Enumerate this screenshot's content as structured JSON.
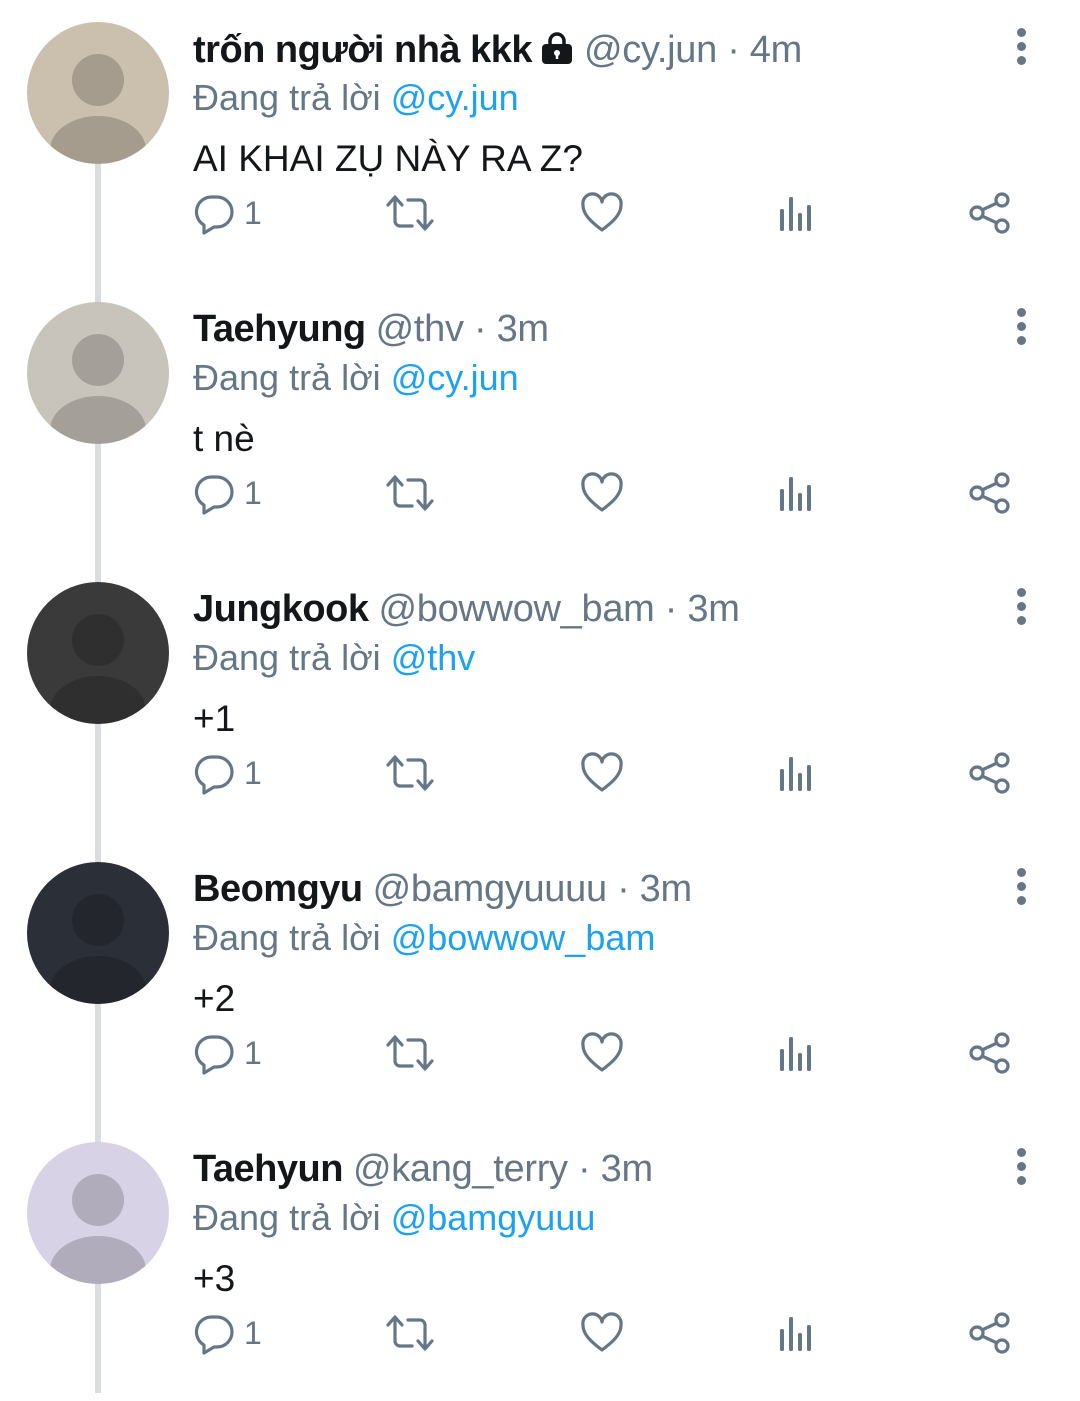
{
  "tweets": [
    {
      "name": "trốn người nhà kkk",
      "handle": "@cy.jun",
      "time": "4m",
      "protected": true,
      "replying_label": "Đang trả lời",
      "reply_to": "@cy.jun",
      "text": "AI KHAI ZỤ NÀY RA Z?",
      "reply_count": "1",
      "avatar_color": "#cbbfae"
    },
    {
      "name": "Taehyung",
      "handle": "@thv",
      "time": "3m",
      "protected": false,
      "replying_label": "Đang trả lời",
      "reply_to": "@cy.jun",
      "text": "t nè",
      "reply_count": "1",
      "avatar_color": "#c9c4bb"
    },
    {
      "name": "Jungkook",
      "handle": "@bowwow_bam",
      "time": "3m",
      "protected": false,
      "replying_label": "Đang trả lời",
      "reply_to": "@thv",
      "text": "+1",
      "reply_count": "1",
      "avatar_color": "#3a3a3a"
    },
    {
      "name": "Beomgyu",
      "handle": "@bamgyuuuu",
      "time": "3m",
      "protected": false,
      "replying_label": "Đang trả lời",
      "reply_to": "@bowwow_bam",
      "text": "+2",
      "reply_count": "1",
      "avatar_color": "#2b2f38"
    },
    {
      "name": "Taehyun",
      "handle": "@kang_terry",
      "time": "3m",
      "protected": false,
      "replying_label": "Đang trả lời",
      "reply_to": "@bamgyuuu",
      "text": "+3",
      "reply_count": "1",
      "avatar_color": "#d7d2e6"
    }
  ],
  "colors": {
    "text": "#14171a",
    "secondary": "#657786",
    "link": "#1da1f2",
    "thread_line": "#d9dde0"
  },
  "icons": [
    "reply-icon",
    "retweet-icon",
    "like-icon",
    "analytics-icon",
    "share-icon",
    "more-icon",
    "lock-icon"
  ]
}
